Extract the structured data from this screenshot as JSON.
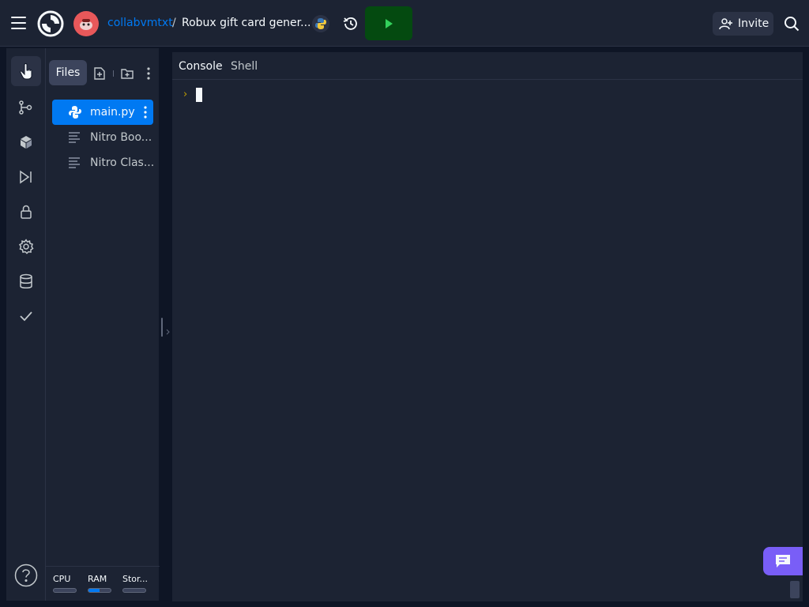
{
  "header": {
    "user": "collabvmtxt",
    "separator": "/",
    "repl_title": "Robux gift card gener...",
    "invite_label": "Invite"
  },
  "sidebar": {
    "icons": [
      "files-icon",
      "version-control-icon",
      "packages-icon",
      "debugger-icon",
      "secrets-icon",
      "settings-icon",
      "database-icon",
      "tests-icon",
      "help-icon"
    ]
  },
  "files": {
    "tab_label": "Files",
    "items": [
      {
        "name": "main.py",
        "type": "python",
        "selected": true
      },
      {
        "name": "Nitro Boo...",
        "type": "text",
        "selected": false
      },
      {
        "name": "Nitro Clas...",
        "type": "text",
        "selected": false
      }
    ]
  },
  "resources": {
    "cpu_label": "CPU",
    "ram_label": "RAM",
    "storage_label": "Stor...",
    "cpu_usage": 0,
    "ram_usage": 0.5,
    "storage_usage": 0
  },
  "workspace": {
    "tabs": [
      "Console",
      "Shell"
    ],
    "active_tab": "Console",
    "prompt_symbol": "›"
  },
  "colors": {
    "accent": "#0079f2",
    "run": "#044a10",
    "chat": "#795ef7",
    "background": "#0e1525",
    "surface": "#1c2333"
  }
}
